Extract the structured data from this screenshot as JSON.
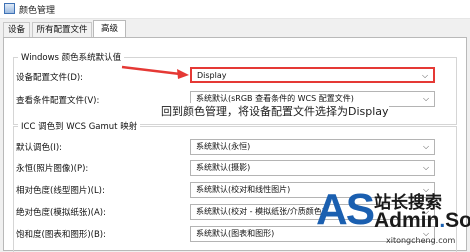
{
  "window": {
    "title": "颜色管理"
  },
  "tabs": [
    {
      "label": "设备"
    },
    {
      "label": "所有配置文件"
    },
    {
      "label": "高级"
    }
  ],
  "windows_defaults": {
    "legend": "Windows 颜色系统默认值",
    "device_profile": {
      "label": "设备配置文件(D):",
      "value": "Display"
    },
    "viewing_conditions": {
      "label": "查看条件配置文件(V):",
      "value": "系统默认(sRGB 查看条件的 WCS 配置文件)"
    }
  },
  "annotation": "回到颜色管理，将设备配置文件选择为Display",
  "icc_mapping": {
    "legend": "ICC 调色到 WCS Gamut 映射",
    "rows": [
      {
        "label": "默认调色(I):",
        "value": "系统默认(永恒)"
      },
      {
        "label": "永恒(照片图像)(P):",
        "value": "系统默认(摄影)"
      },
      {
        "label": "相对色度(线型图片)(L):",
        "value": "系统默认(校对和线性图片)"
      },
      {
        "label": "绝对色度(模拟纸张)(A):",
        "value": "系统默认(校对 - 模拟纸张/介质颜色)"
      },
      {
        "label": "饱和度(图表和图形)(B):",
        "value": "系统默认(图表和图形)"
      }
    ]
  },
  "watermark": {
    "logo": "AS",
    "chinese": "站长搜索",
    "brand_a": "Admin",
    "brand_b": "So",
    "brand_dot": ".",
    "url": "xitongcheng.com"
  },
  "colors": {
    "highlight": "#e53935",
    "arrow": "#e53935",
    "logo_blue": "#1a5fb0"
  }
}
